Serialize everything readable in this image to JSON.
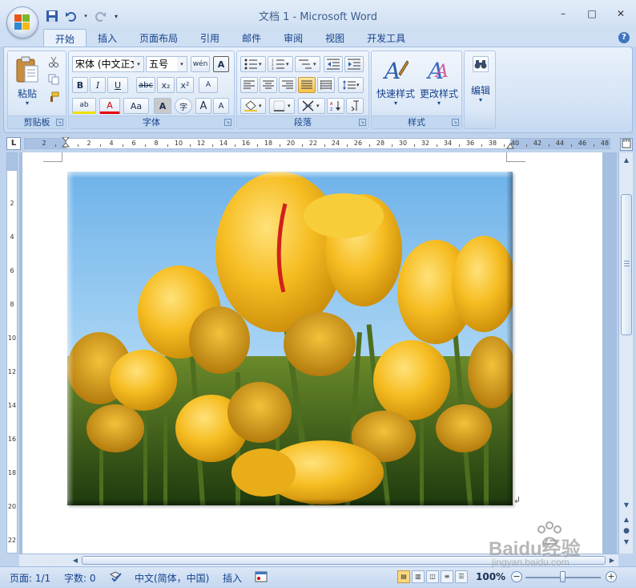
{
  "window": {
    "title": "文档 1 - Microsoft Word",
    "minimize": "–",
    "maximize": "□",
    "close": "✕"
  },
  "tabs": [
    "开始",
    "插入",
    "页面布局",
    "引用",
    "邮件",
    "审阅",
    "视图",
    "开发工具"
  ],
  "active_tab": "开始",
  "help": "?",
  "ribbon": {
    "clipboard": {
      "label": "剪贴板",
      "paste": "粘贴",
      "paste_arrow": "▾"
    },
    "font": {
      "label": "字体",
      "font_name": "宋体 (中文正文)",
      "font_size": "五号",
      "phonetic": "wén",
      "border_char": "A",
      "bold": "B",
      "italic": "I",
      "underline": "U",
      "strike": "abc",
      "subscript": "x₂",
      "superscript": "x²",
      "clear_format": "A",
      "highlight": "ab",
      "font_color": "A",
      "change_case": "Aa",
      "shading": "A",
      "enclose": "字",
      "grow": "A",
      "shrink": "A"
    },
    "paragraph": {
      "label": "段落"
    },
    "styles": {
      "label": "样式",
      "quick_styles": "快速样式",
      "change_styles": "更改样式",
      "arrow": "▾"
    },
    "editing": {
      "label": "编辑",
      "arrow": "▾"
    }
  },
  "ruler": {
    "corner": "L",
    "h_numbers": [
      "2",
      "2",
      "4",
      "6",
      "8",
      "10",
      "12",
      "14",
      "16",
      "18",
      "20",
      "22",
      "24",
      "26",
      "28",
      "30",
      "32",
      "34",
      "36",
      "38",
      "40",
      "42",
      "44",
      "46",
      "48"
    ],
    "v_numbers": [
      "2",
      "4",
      "6",
      "8",
      "10",
      "12",
      "14",
      "16",
      "18",
      "20",
      "22"
    ]
  },
  "document": {
    "paragraph_mark": "↲"
  },
  "statusbar": {
    "page": "页面: 1/1",
    "words": "字数: 0",
    "language": "中文(简体，中国)",
    "mode": "插入",
    "zoom": "100%",
    "zoom_out": "−",
    "zoom_in": "+"
  },
  "watermark": {
    "brand": "Baidu经验",
    "url": "jingyan.baidu.com"
  },
  "colors": {
    "ribbon_text": "#15428b",
    "tulip_yellow": "#f2b41c",
    "sky_blue": "#8fc3ec",
    "stem_green": "#4d6e1e"
  }
}
